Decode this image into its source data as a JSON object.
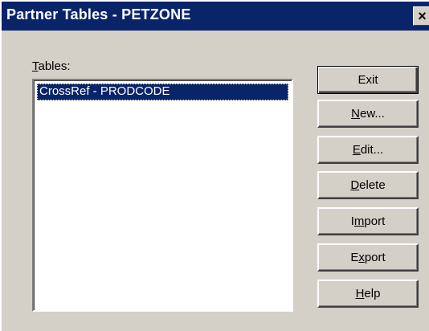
{
  "window": {
    "title": "Partner Tables - PETZONE",
    "close_glyph": "×"
  },
  "tables": {
    "label_key": "T",
    "label_rest": "ables:",
    "items": [
      "CrossRef - PRODCODE"
    ],
    "selected_index": 0
  },
  "buttons": {
    "exit": {
      "label": "Exit"
    },
    "new": {
      "pre": "",
      "key": "N",
      "post": "ew..."
    },
    "edit": {
      "pre": "",
      "key": "E",
      "post": "dit..."
    },
    "delete": {
      "pre": "",
      "key": "D",
      "post": "elete"
    },
    "import": {
      "pre": "I",
      "key": "m",
      "post": "port"
    },
    "export": {
      "pre": "E",
      "key": "x",
      "post": "port"
    },
    "help": {
      "pre": "",
      "key": "H",
      "post": "elp"
    }
  },
  "colors": {
    "titlebar": "#0a246a",
    "selection": "#0a246a",
    "face": "#d4d0c8"
  }
}
